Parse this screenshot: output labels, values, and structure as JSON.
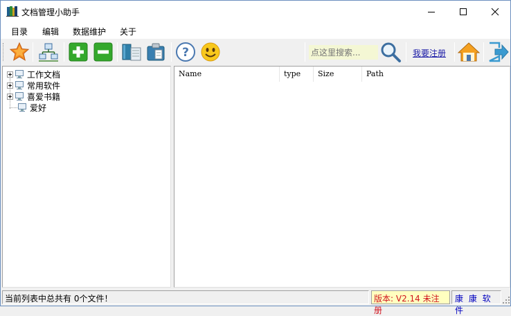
{
  "window": {
    "title": "文档管理小助手"
  },
  "menu": {
    "items": [
      "目录",
      "编辑",
      "数据维护",
      "关于"
    ]
  },
  "toolbar": {
    "search_placeholder": "点这里搜索...",
    "register_label": "我要注册"
  },
  "tree": {
    "nodes": [
      {
        "label": "工作文档",
        "expandable": true
      },
      {
        "label": "常用软件",
        "expandable": true
      },
      {
        "label": "喜爱书籍",
        "expandable": true
      },
      {
        "label": "爱好",
        "expandable": false
      }
    ]
  },
  "list": {
    "columns": [
      "Name",
      "type",
      "Size",
      "Path"
    ],
    "rows": []
  },
  "status": {
    "message": "当前列表中总共有 0个文件！",
    "version": "版本: V2.14 未注册",
    "company": "康 康 软 件"
  },
  "colors": {
    "accent_green": "#34a82c",
    "version_red": "#d0141e",
    "company_blue": "#0000c0"
  }
}
